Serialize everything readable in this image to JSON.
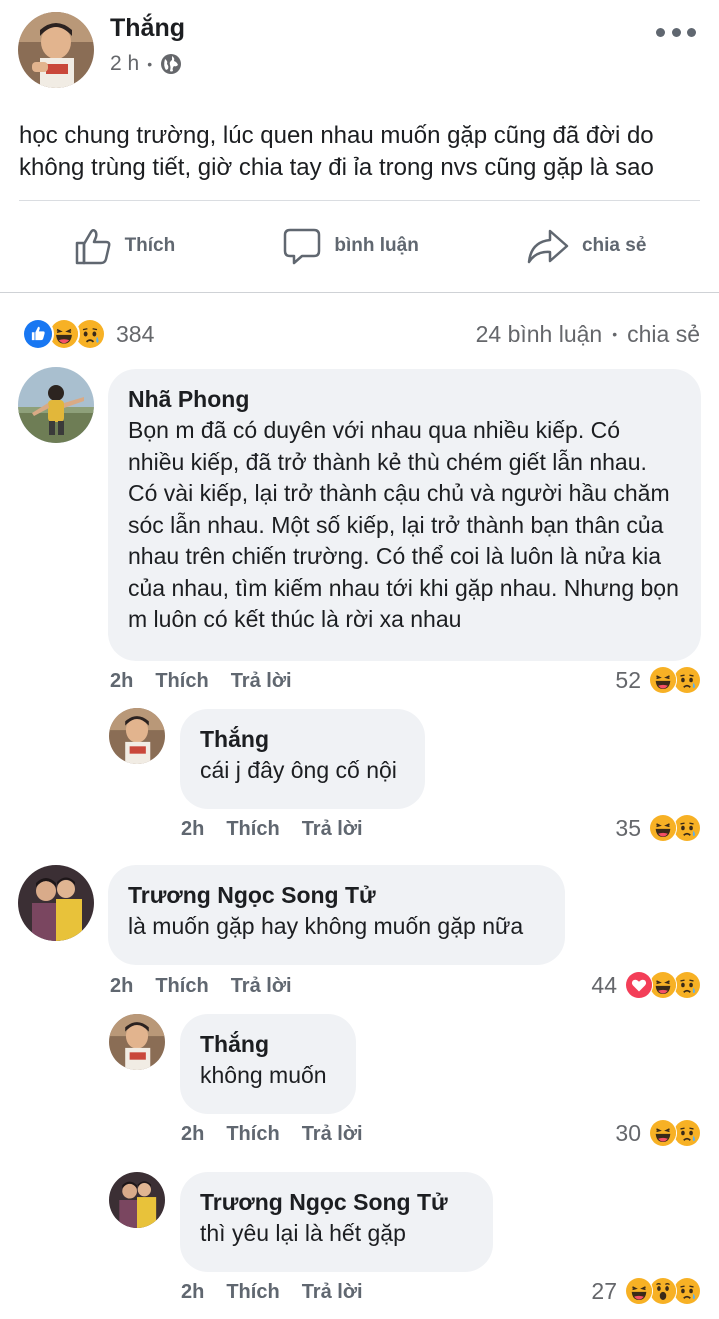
{
  "post": {
    "author": "Thắng",
    "time": "2 h",
    "separator": "•",
    "text": "học chung trường, lúc quen nhau muốn gặp cũng đã đời do không trùng tiết, giờ chia tay đi ỉa trong nvs cũng gặp là sao"
  },
  "actions": {
    "like": "Thích",
    "comment": "bình luận",
    "share": "chia sẻ"
  },
  "summary": {
    "reaction_count": "384",
    "comment_count": "24",
    "comment_label": "bình luận",
    "separator": "•",
    "share_label": "chia sẻ",
    "reactions": [
      "like-icon",
      "haha-icon",
      "sad-icon"
    ]
  },
  "comment_actions": {
    "like": "Thích",
    "reply": "Trả lời"
  },
  "comments": [
    {
      "author": "Nhã Phong",
      "text": "Bọn m đã có duyên với nhau qua nhiều kiếp. Có nhiều kiếp, đã trở thành kẻ thù chém giết lẫn nhau. Có vài kiếp, lại trở thành cậu chủ và người hầu chăm sóc lẫn nhau. Một số kiếp, lại trở thành bạn thân của nhau trên chiến trường. Có thể coi là luôn là nửa kia của nhau, tìm kiếm nhau tới khi gặp nhau. Nhưng bọn m luôn có kết thúc là rời xa nhau",
      "time": "2h",
      "reaction_count": "52",
      "reactions": [
        "haha-icon",
        "sad-icon"
      ]
    },
    {
      "author": "Thắng",
      "text": "cái j đây ông cố nội",
      "time": "2h",
      "reaction_count": "35",
      "reactions": [
        "haha-icon",
        "sad-icon"
      ]
    },
    {
      "author": "Trương Ngọc Song Tử",
      "text": "là muốn gặp hay không muốn gặp nữa",
      "time": "2h",
      "reaction_count": "44",
      "reactions": [
        "love-icon",
        "haha-icon",
        "sad-icon"
      ]
    },
    {
      "author": "Thắng",
      "text": "không muốn",
      "time": "2h",
      "reaction_count": "30",
      "reactions": [
        "haha-icon",
        "sad-icon"
      ]
    },
    {
      "author": "Trương Ngọc Song Tử",
      "text": "thì yêu lại là hết gặp",
      "time": "2h",
      "reaction_count": "27",
      "reactions": [
        "haha-icon",
        "wow-icon",
        "sad-icon"
      ]
    }
  ],
  "colors": {
    "like_blue": "#1877f2",
    "emoji_yellow": "#f7b125",
    "love_red": "#f33e58",
    "bubble_bg": "#f0f2f5",
    "secondary_text": "#65676b"
  }
}
